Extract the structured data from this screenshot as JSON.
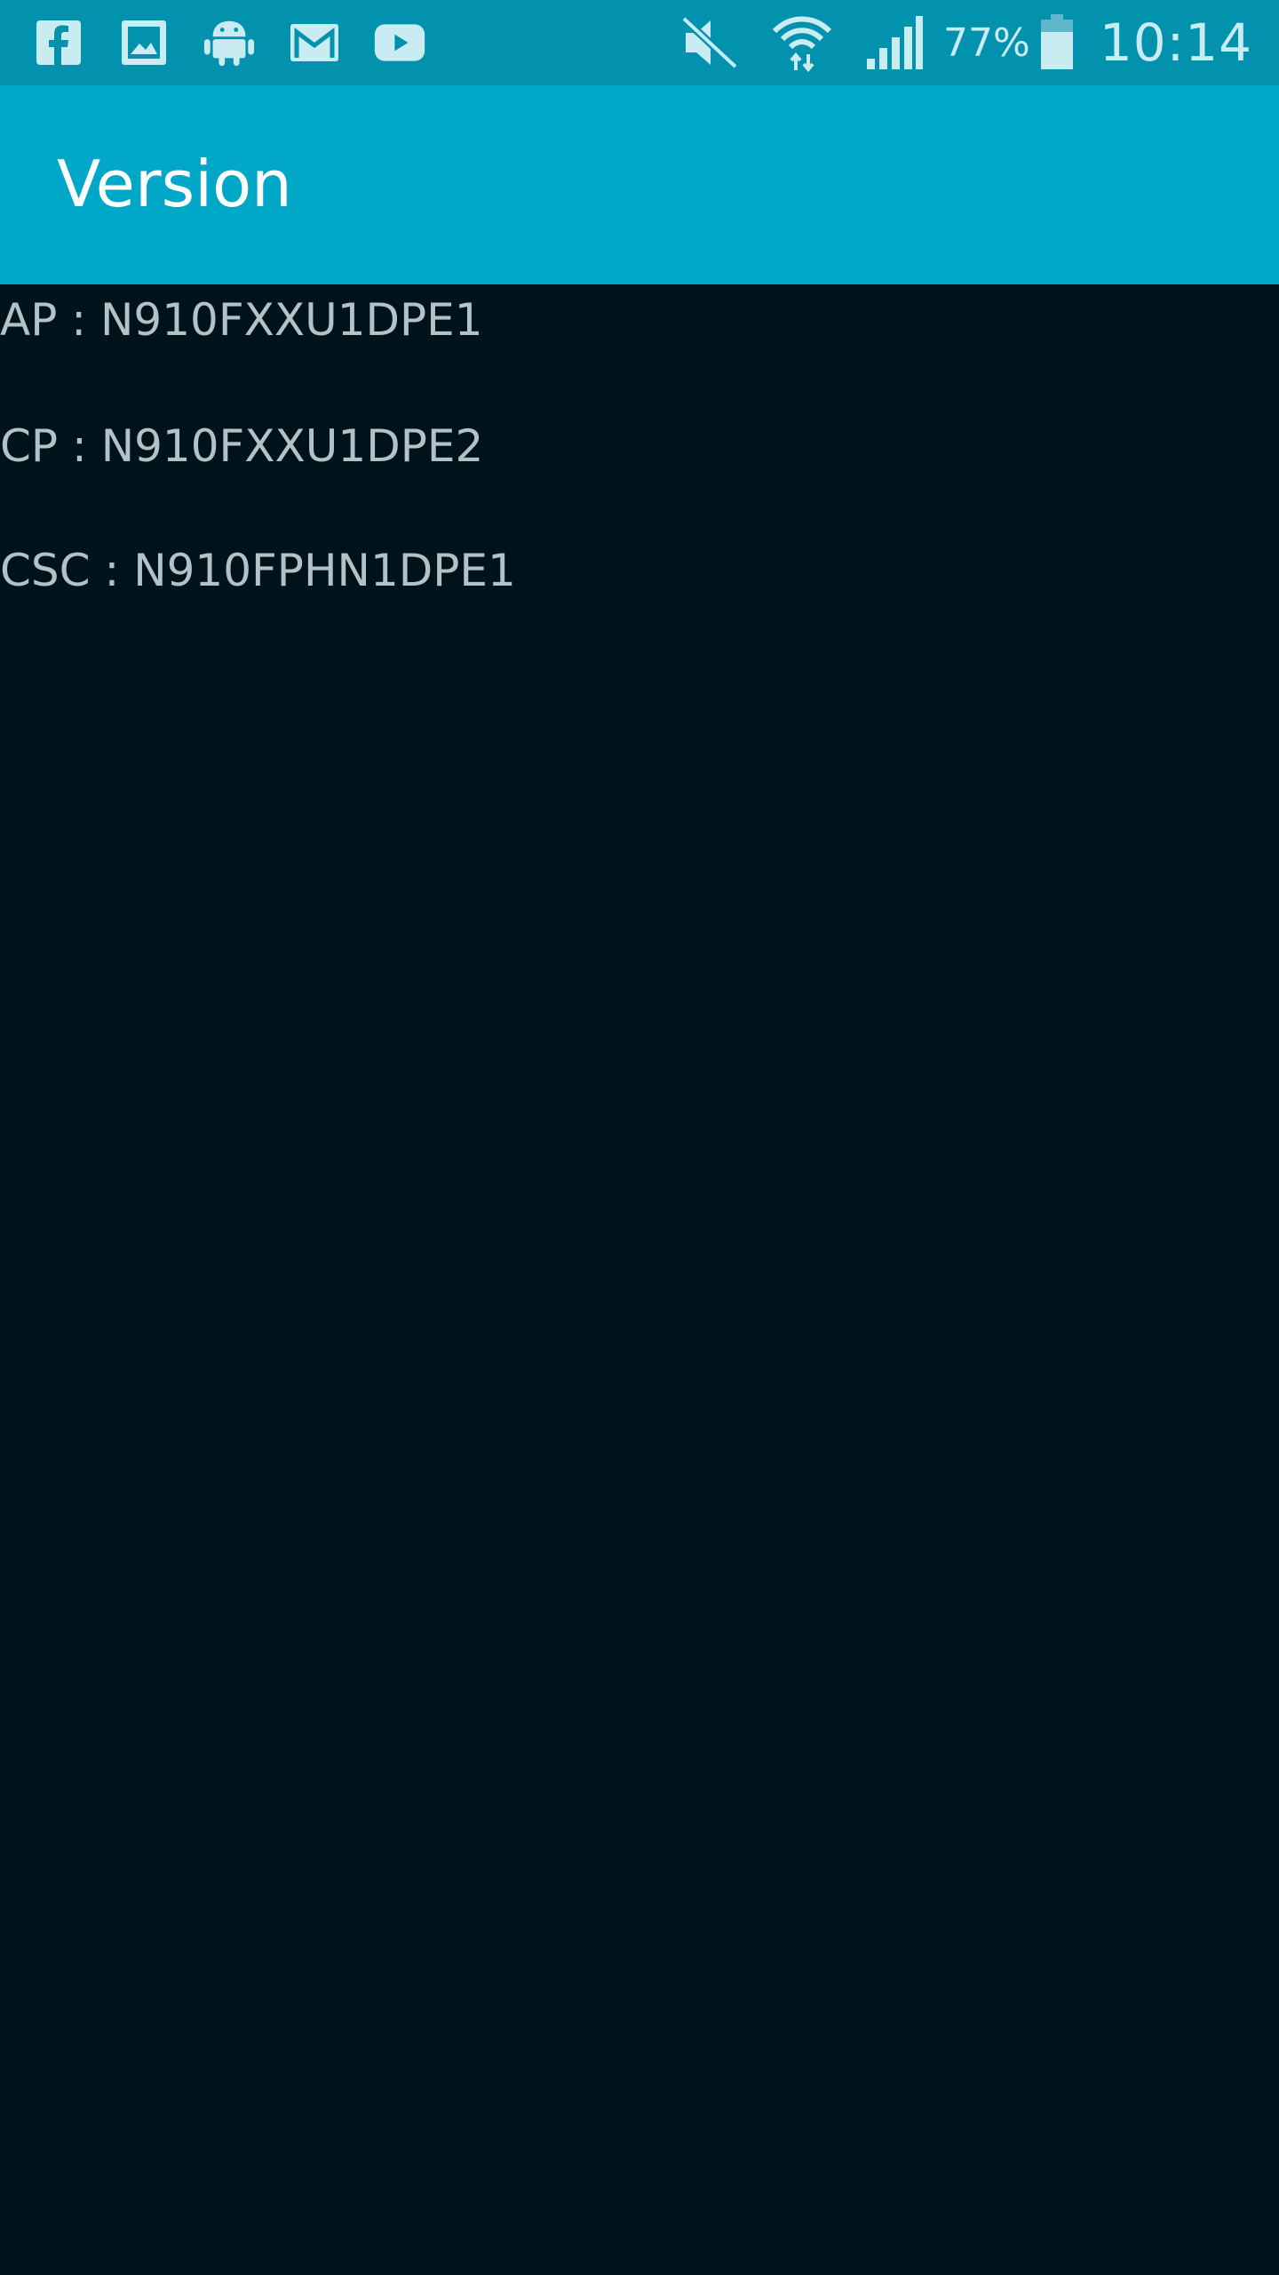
{
  "status_bar": {
    "notification_icons": [
      "facebook-icon",
      "gallery-icon",
      "android-icon",
      "gmail-icon",
      "youtube-icon"
    ],
    "system_icons": [
      "mute-icon",
      "wifi-icon",
      "cell-signal-icon"
    ],
    "battery_percent": "77%",
    "time": "10:14"
  },
  "app_bar": {
    "title": "Version"
  },
  "versions": {
    "ap": "AP : N910FXXU1DPE1",
    "cp": "CP : N910FXXU1DPE2",
    "csc": "CSC : N910FPHN1DPE1"
  },
  "colors": {
    "status_bar_bg": "#0392ae",
    "app_bar_bg": "#01a7c6",
    "content_bg": "#00131b",
    "text": "#b3c2c9",
    "icon": "#c8ecf2"
  }
}
